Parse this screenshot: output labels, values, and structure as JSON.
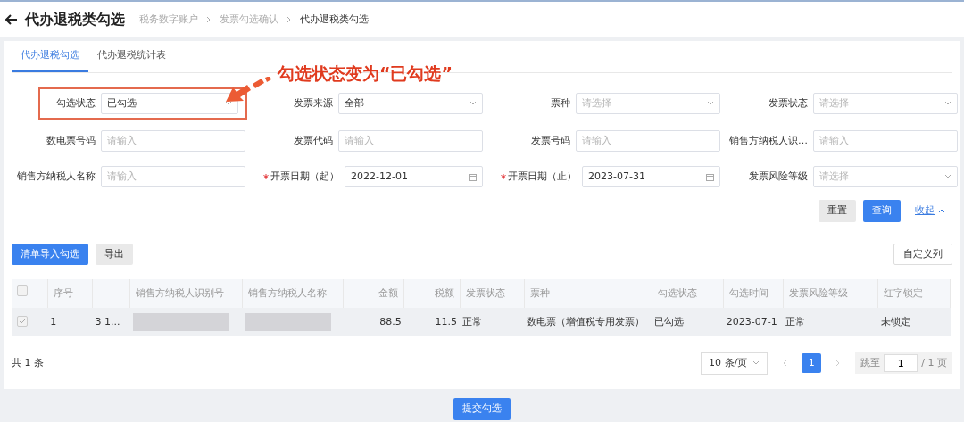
{
  "header": {
    "title": "代办退税类勾选",
    "breadcrumb": [
      {
        "label": "税务数字账户",
        "current": false
      },
      {
        "label": "发票勾选确认",
        "current": false
      },
      {
        "label": "代办退税类勾选",
        "current": true
      }
    ]
  },
  "tabs": [
    {
      "label": "代办退税勾选",
      "selected": true
    },
    {
      "label": "代办退税统计表",
      "selected": false
    }
  ],
  "annotation": {
    "text": "勾选状态变为“已勾选”"
  },
  "filters": [
    {
      "label": "勾选状态",
      "kind": "select",
      "value": "已勾选",
      "required": false,
      "highlighted": true
    },
    {
      "label": "发票来源",
      "kind": "select",
      "value": "全部",
      "required": false,
      "highlighted": false
    },
    {
      "label": "票种",
      "kind": "select",
      "placeholder": "请选择",
      "required": false,
      "highlighted": false
    },
    {
      "label": "发票状态",
      "kind": "select",
      "placeholder": "请选择",
      "required": false,
      "highlighted": false
    },
    {
      "label": "数电票号码",
      "kind": "input",
      "placeholder": "请输入",
      "required": false,
      "highlighted": false
    },
    {
      "label": "发票代码",
      "kind": "input",
      "placeholder": "请输入",
      "required": false,
      "highlighted": false
    },
    {
      "label": "发票号码",
      "kind": "input",
      "placeholder": "请输入",
      "required": false,
      "highlighted": false
    },
    {
      "label": "销售方纳税人识…",
      "kind": "input",
      "placeholder": "请输入",
      "required": false,
      "highlighted": false
    },
    {
      "label": "销售方纳税人名称",
      "kind": "input",
      "placeholder": "请输入",
      "required": false,
      "highlighted": false
    },
    {
      "label": "开票日期（起）",
      "kind": "date",
      "value": "2022-12-01",
      "required": true,
      "highlighted": false
    },
    {
      "label": "开票日期（止）",
      "kind": "date",
      "value": "2023-07-31",
      "required": true,
      "highlighted": false
    },
    {
      "label": "发票风险等级",
      "kind": "select",
      "placeholder": "请选择",
      "required": false,
      "highlighted": false
    }
  ],
  "filter_actions": {
    "reset": "重置",
    "query": "查询",
    "collapse": "收起"
  },
  "toolbar": {
    "import": "清单导入勾选",
    "export": "导出",
    "custom_columns": "自定义列"
  },
  "table": {
    "select_all": {
      "checked": false
    },
    "columns": [
      {
        "label": "序号",
        "kind": "text"
      },
      {
        "kind": "text"
      },
      {
        "label": "销售方纳税人识别号",
        "kind": "text"
      },
      {
        "label": "销售方纳税人名称",
        "kind": "text"
      },
      {
        "label": "金额",
        "kind": "amount"
      },
      {
        "label": "税额",
        "kind": "amount"
      },
      {
        "label": "发票状态",
        "kind": "text"
      },
      {
        "label": "票种",
        "kind": "text"
      },
      {
        "label": "勾选状态",
        "kind": "text"
      },
      {
        "label": "勾选时间",
        "kind": "text"
      },
      {
        "label": "发票风险等级",
        "kind": "text"
      },
      {
        "label": "红字锁定",
        "kind": "text"
      }
    ],
    "rows": [
      {
        "checked": true,
        "cells": [
          {
            "text": "1"
          },
          {
            "text": "3 1..."
          },
          {
            "redacted": true
          },
          {
            "redacted": true
          },
          {
            "text": "88.5"
          },
          {
            "text": "11.5"
          },
          {
            "text": "正常"
          },
          {
            "text": "数电票（增值税专用发票）"
          },
          {
            "text": "已勾选"
          },
          {
            "text": "2023-07-1"
          },
          {
            "text": "正常"
          },
          {
            "text": "未锁定"
          }
        ]
      }
    ]
  },
  "pagination": {
    "total": "共 1 条",
    "page_size": "10 条/页",
    "pages": [
      {
        "label": "1",
        "selected": true
      }
    ],
    "jump_label": "跳至",
    "jump_value": "1",
    "page_total": "/ 1 页"
  },
  "submit": "提交勾选"
}
